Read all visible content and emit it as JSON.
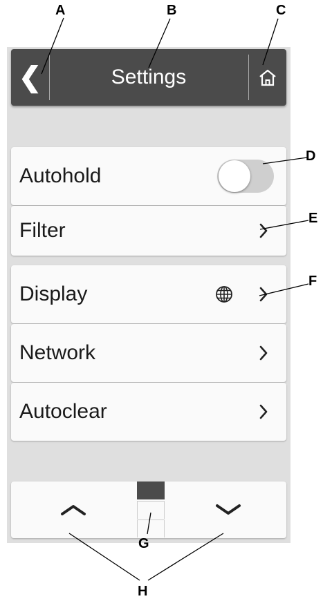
{
  "header": {
    "title": "Settings",
    "back_glyph": "❮"
  },
  "menu": {
    "items": [
      {
        "label": "Autohold",
        "control": "toggle",
        "toggle_on": false
      },
      {
        "label": "Filter",
        "control": "chevron"
      },
      {
        "label": "Display",
        "control": "chevron",
        "extra_icon": "globe-icon"
      },
      {
        "label": "Network",
        "control": "chevron"
      },
      {
        "label": "Autoclear",
        "control": "chevron"
      }
    ]
  },
  "pager": {
    "current_page": 1,
    "total_pages": 3,
    "up_icon": "chevron-up-icon",
    "down_icon": "chevron-down-icon"
  },
  "callouts": {
    "A": "A",
    "B": "B",
    "C": "C",
    "D": "D",
    "E": "E",
    "F": "F",
    "G": "G",
    "H": "H"
  },
  "colors": {
    "header_bg": "#4b4b4b",
    "screen_bg": "#dfdfdf",
    "item_bg": "#fafafa",
    "page_active": "#4b4b4b"
  }
}
